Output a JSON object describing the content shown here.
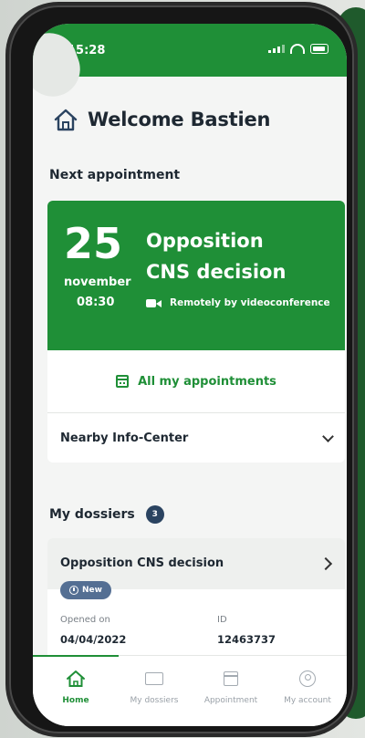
{
  "status_bar": {
    "time": "15:28"
  },
  "header": {
    "title": "Welcome Bastien"
  },
  "next_appointment": {
    "section_title": "Next appointment",
    "day": "25",
    "month": "november",
    "time": "08:30",
    "title_line1": "Opposition",
    "title_line2": "CNS decision",
    "mode": "Remotely by videoconference",
    "all_link": "All my appointments"
  },
  "nearby": {
    "label": "Nearby Info-Center"
  },
  "dossiers": {
    "section_title": "My dossiers",
    "count": "3",
    "items": [
      {
        "name": "Opposition CNS decision",
        "badge": "New",
        "opened_label": "Opened on",
        "opened_value": "04/04/2022",
        "id_label": "ID",
        "id_value": "12463737"
      }
    ]
  },
  "tabs": [
    {
      "label": "Home",
      "icon": "home-icon",
      "active": true
    },
    {
      "label": "My dossiers",
      "icon": "folder-icon"
    },
    {
      "label": "Appointment",
      "icon": "calendar-icon"
    },
    {
      "label": "My account",
      "icon": "user-icon"
    }
  ],
  "colors": {
    "brand_green": "#1f8f37",
    "navy": "#2a4360",
    "badge": "#546f93"
  }
}
